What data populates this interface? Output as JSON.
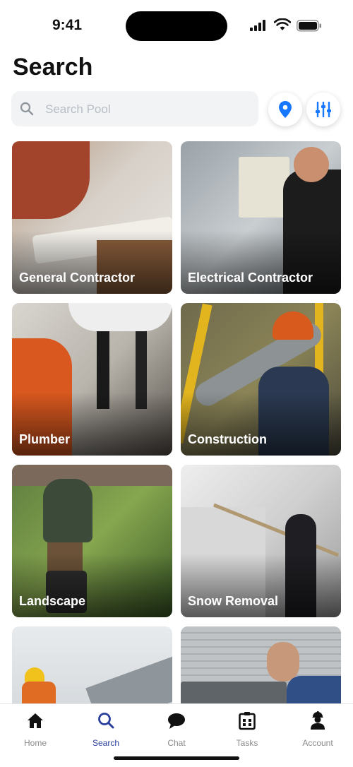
{
  "status_bar": {
    "time": "9:41"
  },
  "header": {
    "title": "Search"
  },
  "search": {
    "placeholder": "Search Pool",
    "value": ""
  },
  "actions": {
    "location_icon": "map-pin-icon",
    "filter_icon": "sliders-icon"
  },
  "categories": [
    {
      "label": "General Contractor",
      "photo": "person reviewing blueprints on a table"
    },
    {
      "label": "Electrical Contractor",
      "photo": "electrician working at a control panel"
    },
    {
      "label": "Plumber",
      "photo": "plumber fixing pipes under a sink"
    },
    {
      "label": "Construction",
      "photo": "worker in orange hard hat carrying a pipe"
    },
    {
      "label": "Landscape",
      "photo": "man pushing a lawn mower in a garden"
    },
    {
      "label": "Snow Removal",
      "photo": "person brushing snow from a roof"
    },
    {
      "label": "",
      "photo": "worker in yellow hard hat on a roof"
    },
    {
      "label": "",
      "photo": "technician servicing an AC unit"
    }
  ],
  "tabbar": {
    "tabs": [
      {
        "label": "Home",
        "icon": "home-icon",
        "active": false
      },
      {
        "label": "Search",
        "icon": "search-icon",
        "active": true
      },
      {
        "label": "Chat",
        "icon": "chat-bubble-icon",
        "active": false
      },
      {
        "label": "Tasks",
        "icon": "tasks-icon",
        "active": false
      },
      {
        "label": "Account",
        "icon": "worker-account-icon",
        "active": false
      }
    ]
  },
  "colors": {
    "accent": "#2a3f9c",
    "pin_blue": "#1677ff",
    "inactive": "#8a8a8a",
    "search_bg": "#f1f3f5"
  }
}
